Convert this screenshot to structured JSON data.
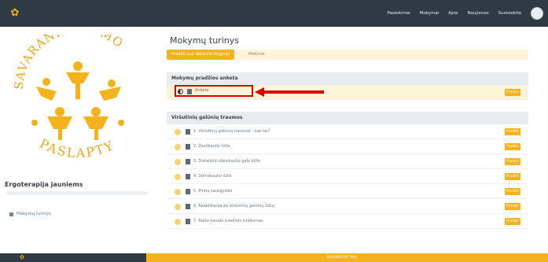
{
  "topbar": {
    "nav": [
      "Pasiekimai",
      "Mokymai",
      "Apie",
      "Naujienos",
      "Susisiekite"
    ]
  },
  "sidebar": {
    "logo_text_top": "SAVARANKIŠKUMO",
    "logo_text_bottom": "PASLAPTYS",
    "course_title": "Ergoterapija jauniems",
    "progress_fraction": 0,
    "items": [
      {
        "label": "Mokymų turinys"
      }
    ]
  },
  "main": {
    "title": "Mokymų turinys",
    "crumb_button": "Pradėti nuo sekančio žingsnio",
    "crumb_text": "Mokiniai",
    "sections": [
      {
        "title": "Mokymų pradžios anketa",
        "items": [
          {
            "label": "Anketa",
            "button": "Pradėti"
          }
        ]
      },
      {
        "title": "Viršutinių galūnių traumos",
        "items": [
          {
            "label": "1. Viršutinių galūnių traumos – kas tai?",
            "button": "Pradėti"
          },
          {
            "label": "2. Žastikaulio lūžis",
            "button": "Pradėti"
          },
          {
            "label": "3. Distalinio stipinkaulio galo lūžis",
            "button": "Pradėti"
          },
          {
            "label": "4. Delnakaulio lūžis",
            "button": "Pradėti"
          },
          {
            "label": "5. Pirštų sausgyslės",
            "button": "Pradėti"
          },
          {
            "label": "6. Reabilitacija po viršutinių galūnių lūžių",
            "button": "Pradėti"
          },
          {
            "label": "7. Riešo kanalo tunelinis sindromas",
            "button": "Pradėti"
          }
        ]
      }
    ]
  },
  "footer": {
    "center_label": "Kontaktinė info"
  },
  "colors": {
    "accent": "#f4b21c",
    "dark": "#2f3a43",
    "highlight": "#fdf3d6",
    "annotation": "#d60000"
  }
}
